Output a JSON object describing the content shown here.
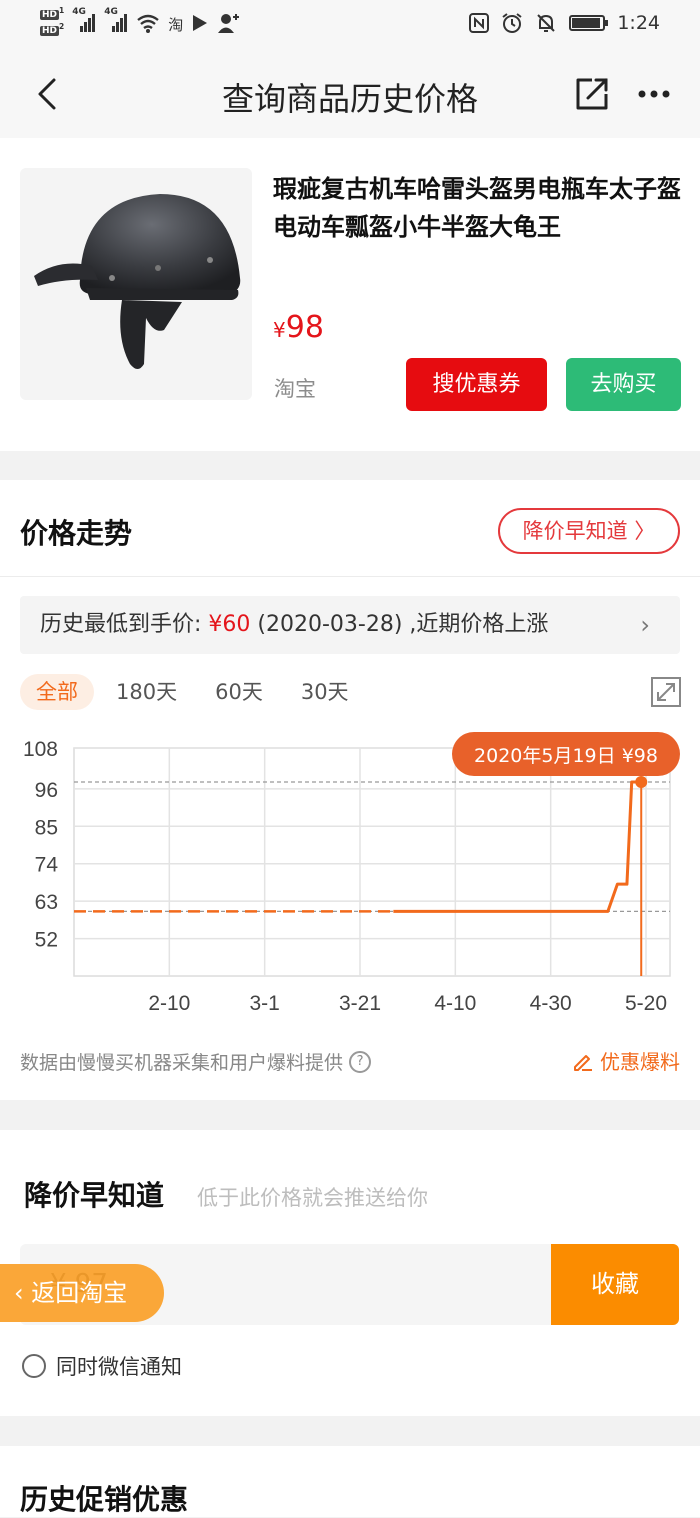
{
  "status_bar": {
    "sim1": "HD",
    "sim1_num": "1",
    "sim2": "HD",
    "sim2_num": "2",
    "net1": "4G",
    "net2": "4G",
    "app_badge": "淘",
    "time": "1:24"
  },
  "nav": {
    "title": "查询商品历史价格"
  },
  "product": {
    "title": "瑕疵复古机车哈雷头盔男电瓶车太子盔电动车瓢盔小牛半盔大龟王",
    "currency": "¥",
    "price": "98",
    "shop": "淘宝",
    "coupon_button": "搜优惠券",
    "buy_button": "去购买"
  },
  "trend": {
    "title": "价格走势",
    "alert_pill": "降价早知道 〉",
    "lowest_label": "历史最低到手价: ",
    "lowest_price": "¥60",
    "lowest_detail": " (2020-03-28) ,近期价格上涨",
    "tabs": [
      {
        "label": "全部",
        "active": true
      },
      {
        "label": "180天",
        "active": false
      },
      {
        "label": "60天",
        "active": false
      },
      {
        "label": "30天",
        "active": false
      }
    ],
    "source_text": "数据由慢慢买机器采集和用户爆料提供",
    "report_label": "优惠爆料"
  },
  "chart_data": {
    "type": "line",
    "title": "",
    "xlabel": "",
    "ylabel": "",
    "y_ticks": [
      "108",
      "96",
      "85",
      "74",
      "63",
      "52"
    ],
    "x_ticks": [
      "2-10",
      "3-1",
      "3-21",
      "4-10",
      "4-30",
      "5-20"
    ],
    "ylim": [
      41,
      108
    ],
    "grid": true,
    "reference_lines": [
      98,
      60
    ],
    "tooltip": "2020年5月19日 ¥98",
    "series": [
      {
        "points": [
          {
            "x": "2020-01-21",
            "y": 60
          },
          {
            "x": "2020-03-28",
            "y": 60
          },
          {
            "x": "2020-05-12",
            "y": 60
          },
          {
            "x": "2020-05-14",
            "y": 68
          },
          {
            "x": "2020-05-16",
            "y": 68
          },
          {
            "x": "2020-05-17",
            "y": 98
          },
          {
            "x": "2020-05-19",
            "y": 98
          }
        ]
      }
    ],
    "colors": {
      "line": "#f26a1c",
      "tooltip": "#e8612a"
    }
  },
  "price_alert": {
    "title": "降价早知道",
    "subtitle": "低于此价格就会推送给你",
    "input_value": "¥ 97",
    "save_button": "收藏",
    "wechat_label": "同时微信通知"
  },
  "floating": {
    "back_label": "返回淘宝"
  },
  "promo": {
    "title": "历史促销优惠"
  }
}
